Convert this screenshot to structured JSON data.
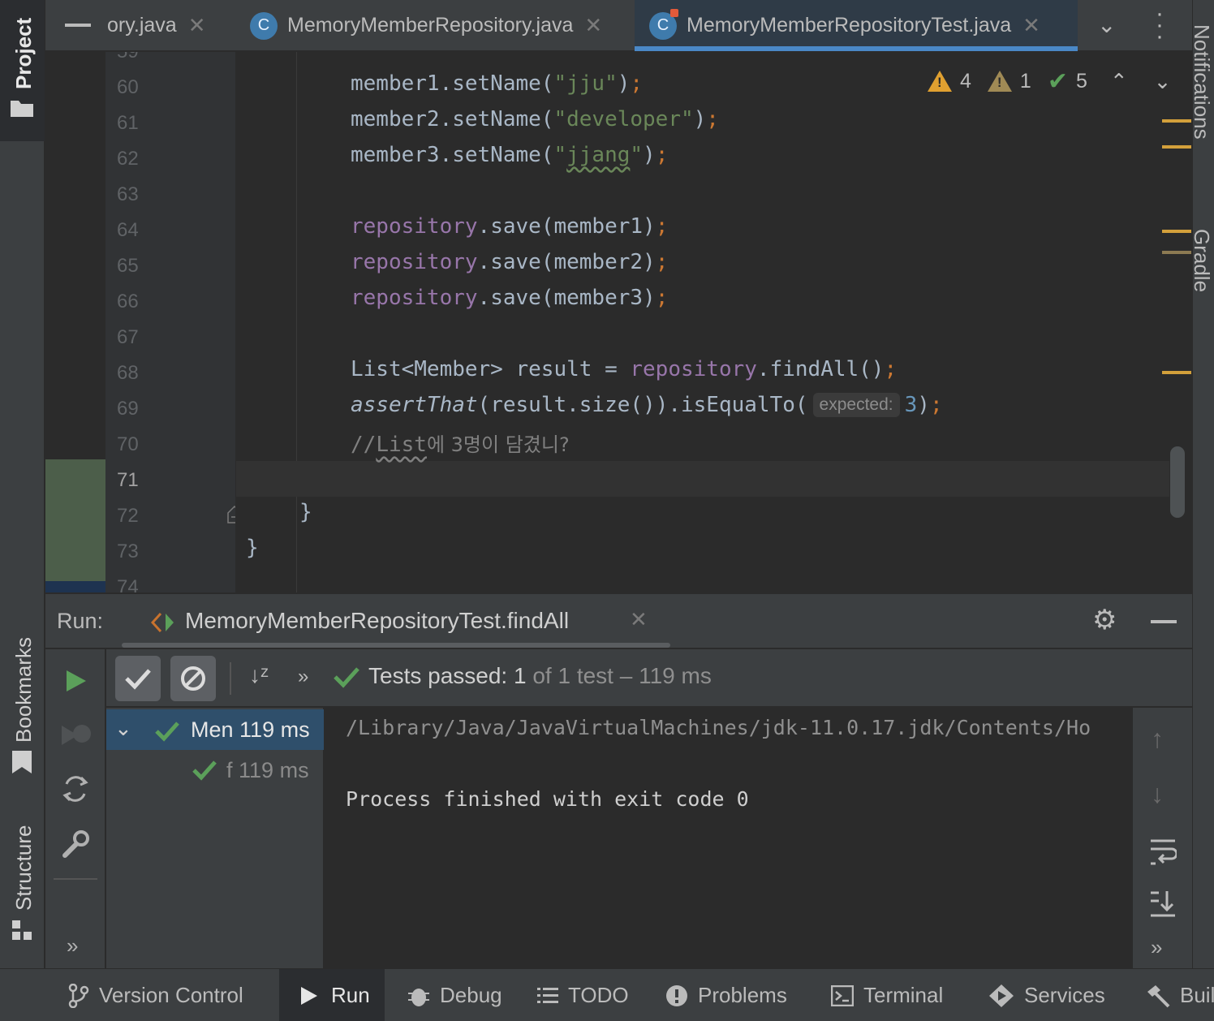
{
  "tabs": [
    {
      "label": "ory.java",
      "icon": "close-icon"
    },
    {
      "label": "MemoryMemberRepository.java",
      "icon": "class-icon"
    },
    {
      "label": "MemoryMemberRepositoryTest.java",
      "icon": "class-icon",
      "active": true
    }
  ],
  "sidebar": {
    "left": {
      "project": "Project",
      "bookmarks": "Bookmarks",
      "structure": "Structure"
    },
    "right": {
      "notifications": "Notifications",
      "gradle": "Gradle"
    }
  },
  "inspections": {
    "warnings": "4",
    "weak_warnings": "1",
    "ok": "5"
  },
  "editor": {
    "lines": [
      {
        "n": "59"
      },
      {
        "n": "60"
      },
      {
        "n": "61"
      },
      {
        "n": "62"
      },
      {
        "n": "63"
      },
      {
        "n": "64"
      },
      {
        "n": "65"
      },
      {
        "n": "66"
      },
      {
        "n": "67"
      },
      {
        "n": "68"
      },
      {
        "n": "69"
      },
      {
        "n": "70"
      },
      {
        "n": "71"
      },
      {
        "n": "72"
      },
      {
        "n": "73"
      },
      {
        "n": "74"
      }
    ],
    "code": {
      "l60_a": "member1.setName(",
      "l60_s": "\"jju\"",
      "l60_b": ")",
      "l61_a": "member2.setName(",
      "l61_s": "\"developer\"",
      "l61_b": ")",
      "l62_a": "member3.setName(",
      "l62_s1": "\"",
      "l62_s2": "jjang",
      "l62_s3": "\"",
      "l62_b": ")",
      "l64_f": "repository",
      "l64_a": ".save(member1)",
      "l65_f": "repository",
      "l65_a": ".save(member2)",
      "l66_f": "repository",
      "l66_a": ".save(member3)",
      "l68_a": "List<Member> result = ",
      "l68_f": "repository",
      "l68_b": ".findAll()",
      "l69_a": "assertThat",
      "l69_b": "(result.size()).isEqualTo(",
      "l69_hint": "expected:",
      "l69_n": "3",
      "l69_c": ")",
      "l70_a": "//",
      "l70_b": "List",
      "l70_c": "에 3명이 담겼니?",
      "semicolon": ";",
      "l72": "}",
      "l73": "}"
    }
  },
  "run": {
    "label": "Run:",
    "config": "MemoryMemberRepositoryTest.findAll",
    "status_prefix": "Tests passed:",
    "status_count": "1",
    "status_rest": "of 1 test – 119 ms",
    "tree": [
      {
        "name": "Men",
        "time": "119 ms"
      },
      {
        "name": "f",
        "time": "119 ms"
      }
    ],
    "console": [
      "/Library/Java/JavaVirtualMachines/jdk-11.0.17.jdk/Contents/Ho",
      "",
      "Process finished with exit code 0"
    ],
    "more": "»"
  },
  "statusbar": [
    {
      "label": "Version Control",
      "icon": "branch-icon"
    },
    {
      "label": "Run",
      "icon": "play-icon",
      "active": true
    },
    {
      "label": "Debug",
      "icon": "bug-icon"
    },
    {
      "label": "TODO",
      "icon": "list-icon"
    },
    {
      "label": "Problems",
      "icon": "warning-circle-icon"
    },
    {
      "label": "Terminal",
      "icon": "terminal-icon"
    },
    {
      "label": "Services",
      "icon": "services-icon"
    },
    {
      "label": "Buil",
      "icon": "hammer-icon"
    }
  ],
  "colors": {
    "accent": "#4a88c7",
    "pass": "#5ba05a",
    "warning": "#e0a030"
  }
}
